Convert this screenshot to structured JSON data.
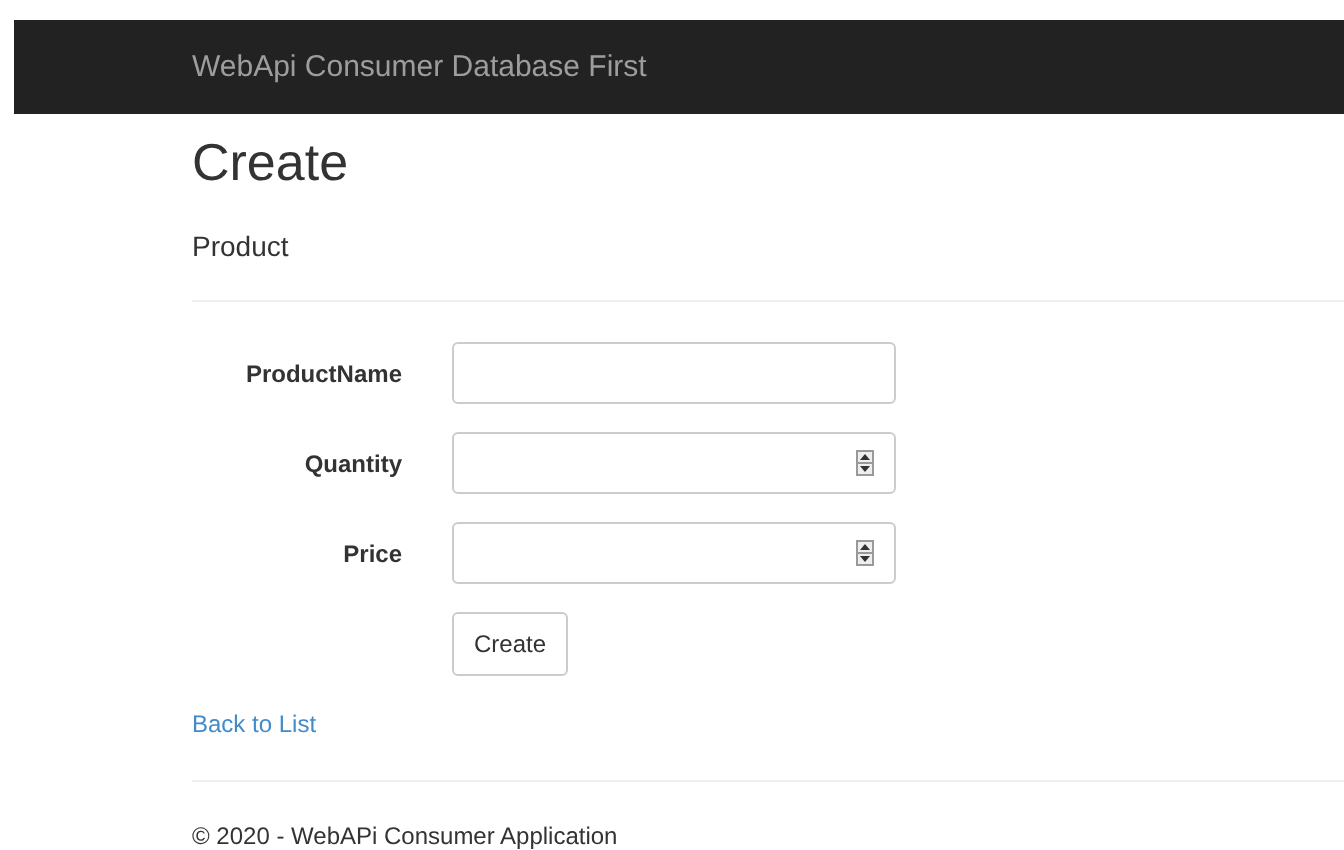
{
  "navbar": {
    "brand": "WebApi Consumer Database First"
  },
  "heading": "Create",
  "subheading": "Product",
  "form": {
    "fields": [
      {
        "label": "ProductName",
        "kind": "text"
      },
      {
        "label": "Quantity",
        "kind": "number"
      },
      {
        "label": "Price",
        "kind": "number"
      }
    ],
    "submit": "Create"
  },
  "back_link": "Back to List",
  "footer": "© 2020 - WebAPi Consumer Application"
}
